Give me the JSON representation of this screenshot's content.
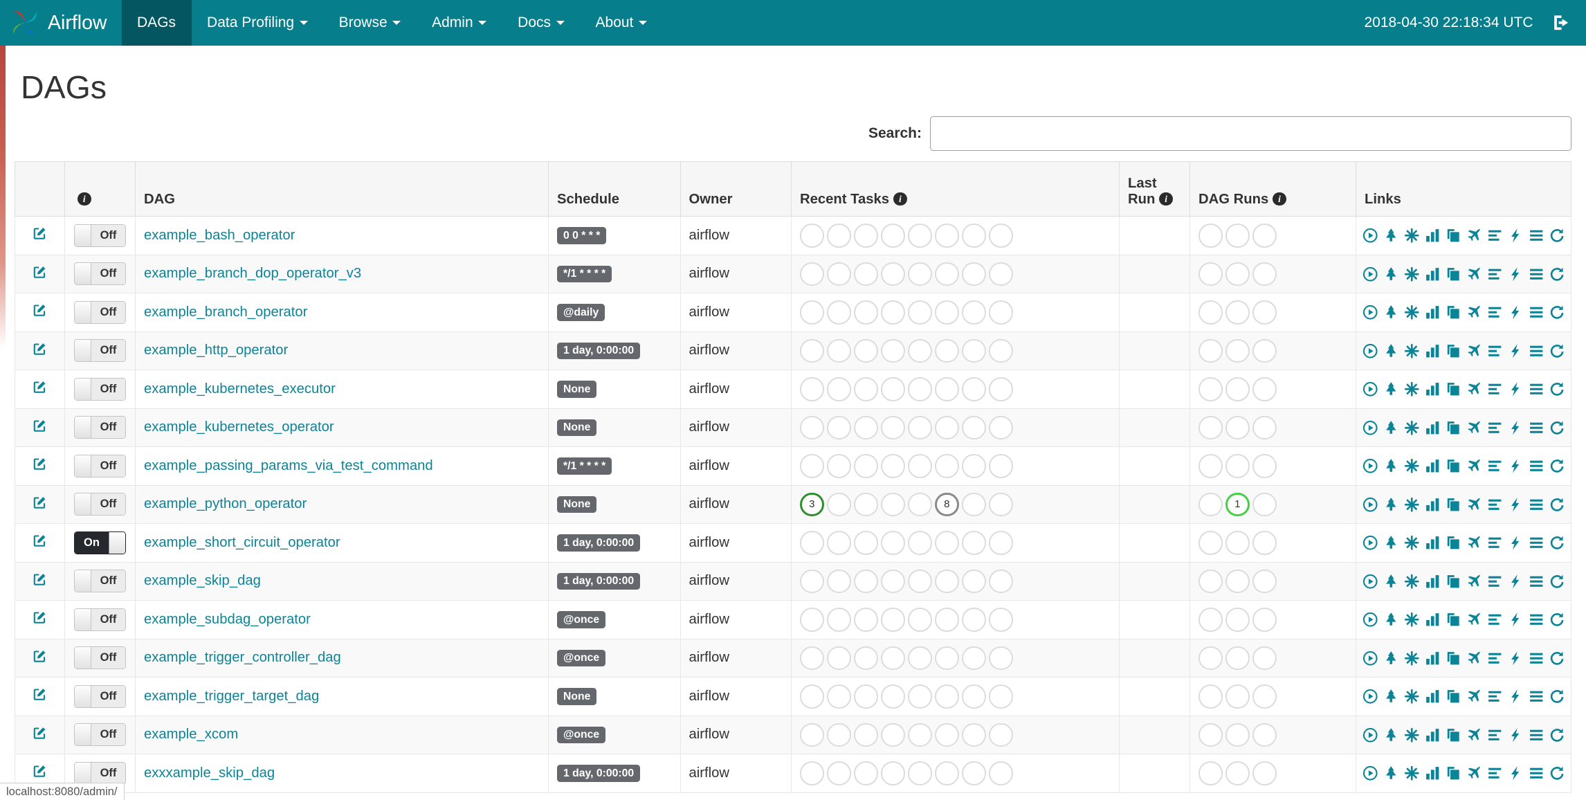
{
  "navbar": {
    "brand": "Airflow",
    "items": [
      {
        "label": "DAGs",
        "active": true,
        "dropdown": false
      },
      {
        "label": "Data Profiling",
        "active": false,
        "dropdown": true
      },
      {
        "label": "Browse",
        "active": false,
        "dropdown": true
      },
      {
        "label": "Admin",
        "active": false,
        "dropdown": true
      },
      {
        "label": "Docs",
        "active": false,
        "dropdown": true
      },
      {
        "label": "About",
        "active": false,
        "dropdown": true
      }
    ],
    "clock": "2018-04-30 22:18:34 UTC"
  },
  "page": {
    "title": "DAGs"
  },
  "search": {
    "label": "Search:",
    "value": ""
  },
  "table": {
    "headers": {
      "dag": "DAG",
      "schedule": "Schedule",
      "owner": "Owner",
      "recent_tasks": "Recent Tasks",
      "last_run": "Last Run",
      "dag_runs": "DAG Runs",
      "links": "Links"
    },
    "recent_task_slots": 8,
    "dag_run_slots": 3,
    "link_icons": [
      "trigger-dag",
      "tree-view",
      "graph-view",
      "task-duration",
      "task-tries",
      "landing-times",
      "gantt-view",
      "code-view",
      "logs",
      "refresh"
    ],
    "rows": [
      {
        "dag": "example_bash_operator",
        "schedule": "0 0 * * *",
        "owner": "airflow",
        "toggle": "Off"
      },
      {
        "dag": "example_branch_dop_operator_v3",
        "schedule": "*/1 * * * *",
        "owner": "airflow",
        "toggle": "Off"
      },
      {
        "dag": "example_branch_operator",
        "schedule": "@daily",
        "owner": "airflow",
        "toggle": "Off"
      },
      {
        "dag": "example_http_operator",
        "schedule": "1 day, 0:00:00",
        "owner": "airflow",
        "toggle": "Off"
      },
      {
        "dag": "example_kubernetes_executor",
        "schedule": "None",
        "owner": "airflow",
        "toggle": "Off"
      },
      {
        "dag": "example_kubernetes_operator",
        "schedule": "None",
        "owner": "airflow",
        "toggle": "Off"
      },
      {
        "dag": "example_passing_params_via_test_command",
        "schedule": "*/1 * * * *",
        "owner": "airflow",
        "toggle": "Off"
      },
      {
        "dag": "example_python_operator",
        "schedule": "None",
        "owner": "airflow",
        "toggle": "Off",
        "recent_tasks": [
          {
            "slot": 0,
            "count": "3",
            "color": "#2e8f2e"
          },
          {
            "slot": 5,
            "count": "8",
            "color": "#8a8a8a"
          }
        ],
        "dag_runs": [
          {
            "slot": 1,
            "count": "1",
            "color": "#44cf44"
          }
        ]
      },
      {
        "dag": "example_short_circuit_operator",
        "schedule": "1 day, 0:00:00",
        "owner": "airflow",
        "toggle": "On"
      },
      {
        "dag": "example_skip_dag",
        "schedule": "1 day, 0:00:00",
        "owner": "airflow",
        "toggle": "Off"
      },
      {
        "dag": "example_subdag_operator",
        "schedule": "@once",
        "owner": "airflow",
        "toggle": "Off"
      },
      {
        "dag": "example_trigger_controller_dag",
        "schedule": "@once",
        "owner": "airflow",
        "toggle": "Off"
      },
      {
        "dag": "example_trigger_target_dag",
        "schedule": "None",
        "owner": "airflow",
        "toggle": "Off"
      },
      {
        "dag": "example_xcom",
        "schedule": "@once",
        "owner": "airflow",
        "toggle": "Off"
      },
      {
        "dag": "exxxample_skip_dag",
        "schedule": "1 day, 0:00:00",
        "owner": "airflow",
        "toggle": "Off"
      }
    ]
  },
  "status_bar": {
    "url": "localhost:8080/admin/"
  },
  "colors": {
    "navbar_bg": "#077e8b",
    "navbar_active_bg": "#045661",
    "accent_link": "#0c8498",
    "schedule_badge_bg": "#64686c",
    "toggle_on_bg": "#25292e",
    "task_success_green": "#2e8f2e",
    "task_grey": "#8a8a8a",
    "dagrun_running_green": "#44cf44",
    "empty_circle_border": "#dcdcdc"
  }
}
